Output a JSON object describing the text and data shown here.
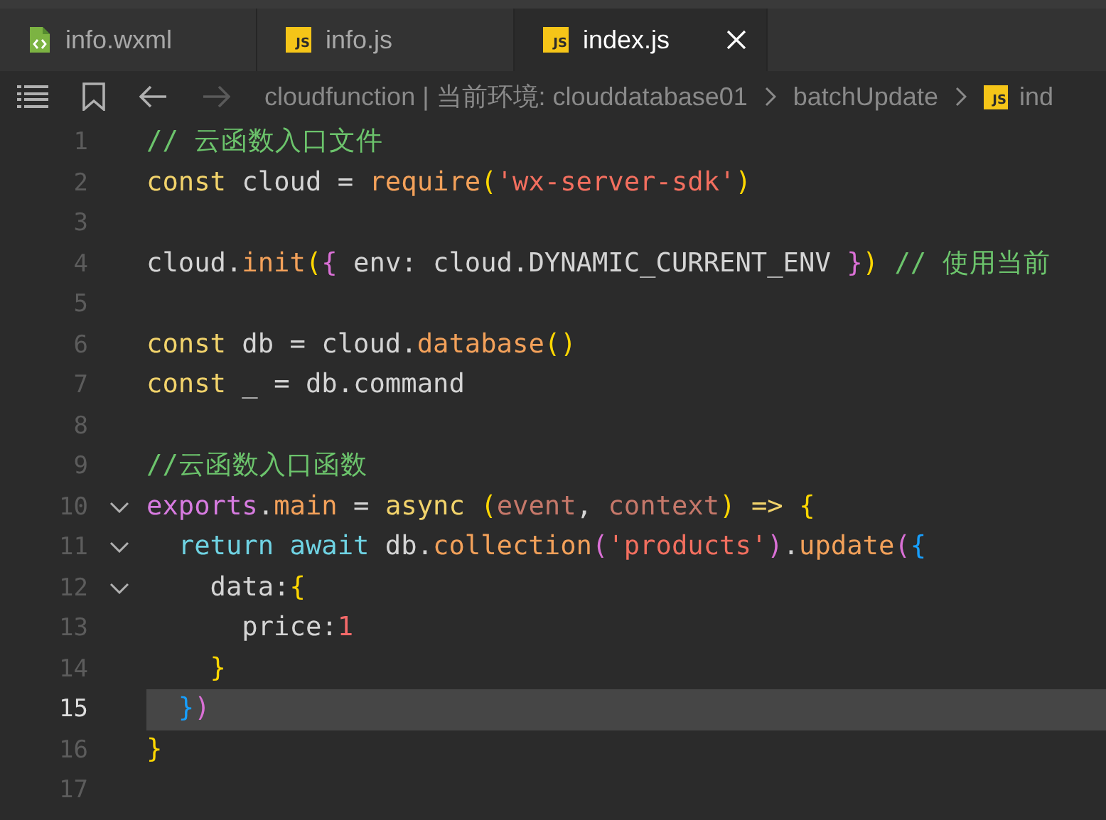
{
  "tabs": [
    {
      "label": "info.wxml",
      "kind": "wxml",
      "selected": false
    },
    {
      "label": "info.js",
      "kind": "js",
      "badge": "JS",
      "selected": false
    },
    {
      "label": "index.js",
      "kind": "js",
      "badge": "JS",
      "selected": true
    }
  ],
  "breadcrumb": [
    {
      "label": "cloudfunction | 当前环境: clouddatabase01",
      "kind": "text"
    },
    {
      "label": "batchUpdate",
      "kind": "text"
    },
    {
      "label": "ind",
      "kind": "file",
      "badge": "JS"
    }
  ],
  "lines": [
    {
      "number": "1",
      "foldable": false,
      "current": false,
      "tokens": [
        {
          "kind": "comment",
          "text": "// 云函数入口文件"
        }
      ]
    },
    {
      "number": "2",
      "foldable": false,
      "current": false,
      "tokens": [
        {
          "kind": "keyword",
          "text": "const"
        },
        {
          "kind": "plain",
          "text": " cloud = "
        },
        {
          "kind": "func",
          "text": "require"
        },
        {
          "kind": "bracket1",
          "text": "("
        },
        {
          "kind": "string",
          "text": "'wx-server-sdk'"
        },
        {
          "kind": "bracket1",
          "text": ")"
        }
      ]
    },
    {
      "number": "3",
      "foldable": false,
      "current": false
    },
    {
      "number": "4",
      "foldable": false,
      "current": false,
      "tokens": [
        {
          "kind": "plain",
          "text": "cloud."
        },
        {
          "kind": "func",
          "text": "init"
        },
        {
          "kind": "bracket1",
          "text": "("
        },
        {
          "kind": "bracket2",
          "text": "{"
        },
        {
          "kind": "plain",
          "text": " env: cloud.DYNAMIC_CURRENT_ENV "
        },
        {
          "kind": "bracket2",
          "text": "}"
        },
        {
          "kind": "bracket1",
          "text": ")"
        },
        {
          "kind": "comment",
          "text": " // 使用当前"
        }
      ]
    },
    {
      "number": "5",
      "foldable": false,
      "current": false
    },
    {
      "number": "6",
      "foldable": false,
      "current": false,
      "tokens": [
        {
          "kind": "keyword",
          "text": "const"
        },
        {
          "kind": "plain",
          "text": " db = cloud."
        },
        {
          "kind": "func",
          "text": "database"
        },
        {
          "kind": "bracket1",
          "text": "()"
        }
      ]
    },
    {
      "number": "7",
      "foldable": false,
      "current": false,
      "tokens": [
        {
          "kind": "keyword",
          "text": "const"
        },
        {
          "kind": "plain",
          "text": " _ = db.command"
        }
      ]
    },
    {
      "number": "8",
      "foldable": false,
      "current": false
    },
    {
      "number": "9",
      "foldable": false,
      "current": false,
      "tokens": [
        {
          "kind": "comment",
          "text": "//云函数入口函数"
        }
      ]
    },
    {
      "number": "10",
      "foldable": true,
      "current": false,
      "tokens": [
        {
          "kind": "builtin",
          "text": "exports"
        },
        {
          "kind": "plain",
          "text": "."
        },
        {
          "kind": "func",
          "text": "main"
        },
        {
          "kind": "plain",
          "text": " = "
        },
        {
          "kind": "keyword",
          "text": "async "
        },
        {
          "kind": "bracket1",
          "text": "("
        },
        {
          "kind": "param",
          "text": "event"
        },
        {
          "kind": "plain",
          "text": ", "
        },
        {
          "kind": "param",
          "text": "context"
        },
        {
          "kind": "bracket1",
          "text": ")"
        },
        {
          "kind": "keyword",
          "text": " => "
        },
        {
          "kind": "bracket1",
          "text": "{"
        }
      ]
    },
    {
      "number": "11",
      "foldable": true,
      "current": false,
      "tokens": [
        {
          "kind": "control",
          "text": "  return"
        },
        {
          "kind": "control",
          "text": " await"
        },
        {
          "kind": "plain",
          "text": " db."
        },
        {
          "kind": "func",
          "text": "collection"
        },
        {
          "kind": "bracket2",
          "text": "("
        },
        {
          "kind": "string",
          "text": "'products'"
        },
        {
          "kind": "bracket2",
          "text": ")"
        },
        {
          "kind": "plain",
          "text": "."
        },
        {
          "kind": "func",
          "text": "update"
        },
        {
          "kind": "bracket2",
          "text": "("
        },
        {
          "kind": "bracket3",
          "text": "{"
        }
      ]
    },
    {
      "number": "12",
      "foldable": true,
      "current": false,
      "tokens": [
        {
          "kind": "plain",
          "text": "    data:"
        },
        {
          "kind": "bracket1",
          "text": "{"
        }
      ]
    },
    {
      "number": "13",
      "foldable": false,
      "current": false,
      "tokens": [
        {
          "kind": "plain",
          "text": "      price:"
        },
        {
          "kind": "number",
          "text": "1"
        }
      ]
    },
    {
      "number": "14",
      "foldable": false,
      "current": false,
      "tokens": [
        {
          "kind": "bracket1",
          "text": "    }"
        }
      ]
    },
    {
      "number": "15",
      "foldable": false,
      "current": true,
      "tokens": [
        {
          "kind": "bracket3",
          "text": "  }"
        },
        {
          "kind": "bracket2",
          "text": ")"
        }
      ]
    },
    {
      "number": "16",
      "foldable": false,
      "current": false,
      "tokens": [
        {
          "kind": "bracket1",
          "text": "}"
        }
      ]
    },
    {
      "number": "17",
      "foldable": false,
      "current": false
    }
  ]
}
